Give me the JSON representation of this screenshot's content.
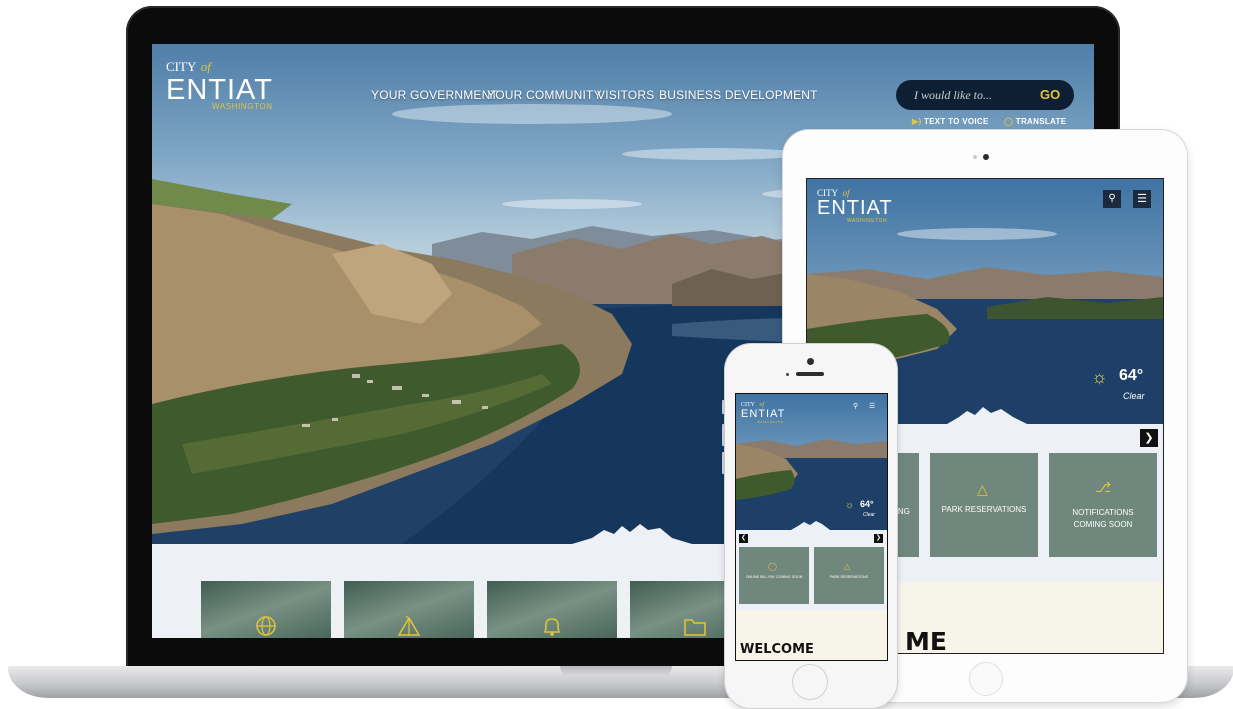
{
  "desktop": {
    "logo": {
      "city": "CITY",
      "of": "of",
      "name": "ENTIAT",
      "state": "WASHINGTON"
    },
    "nav": [
      "YOUR GOVERNMENT",
      "YOUR COMMUNITY",
      "VISITORS",
      "BUSINESS DEVELOPMENT"
    ],
    "search": {
      "placeholder": "I would like to...",
      "go": "GO"
    },
    "utility": {
      "text_to_voice": "TEXT TO VOICE",
      "translate": "TRANSLATE"
    },
    "card_icons": [
      "globe-icon",
      "tent-icon",
      "bell-icon",
      "folder-icon"
    ]
  },
  "tablet": {
    "logo": {
      "city": "CITY",
      "of": "of",
      "name": "ENTIAT",
      "state": "WASHINGTON"
    },
    "weather": {
      "temp": "64°",
      "condition": "Clear"
    },
    "cards": [
      "MING",
      "PARK RESERVATIONS",
      "NOTIFICATIONS COMING SOON"
    ],
    "welcome_partial": "ME"
  },
  "phone": {
    "logo": {
      "city": "CITY",
      "of": "of",
      "name": "ENTIAT",
      "state": "WASHINGTON"
    },
    "weather": {
      "temp": "64°",
      "condition": "Clear"
    },
    "cards": [
      "ONLINE BILL PAY COMING SOON",
      "PARK RESERVATIONS"
    ],
    "welcome": "WELCOME"
  },
  "colors": {
    "accent": "#e3c53a",
    "navy": "#0f1f33",
    "card": "#6c8479",
    "light": "#edf1f5",
    "cream": "#f7f5ea"
  }
}
